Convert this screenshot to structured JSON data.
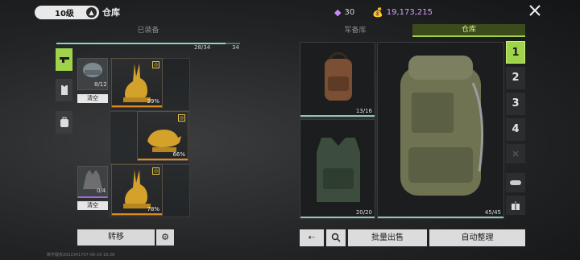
{
  "header": {
    "level_label": "10级",
    "title": "仓库",
    "gems": "30",
    "coins": "19,173,215"
  },
  "left_panel": {
    "section_title": "已装备",
    "capacity_main": "28/34",
    "capacity_side": "34",
    "slot1_count": "8/12",
    "slot2_count": "0/4",
    "clear_label": "清空",
    "items": [
      {
        "percent": "29%"
      },
      {
        "percent": "66%"
      },
      {
        "percent": "78%"
      }
    ],
    "move_label": "转移",
    "version": "数字版权2022341707-06-19-16:28"
  },
  "right_panel": {
    "tab_armory": "军备库",
    "tab_warehouse": "仓库",
    "bags": [
      {
        "capacity": "13/16"
      },
      {
        "capacity": "20/20"
      },
      {
        "capacity": "45/45"
      }
    ],
    "number_tabs": [
      "1",
      "2",
      "3",
      "4"
    ],
    "batch_sell_label": "批量出售",
    "auto_sort_label": "自动整理"
  },
  "colors": {
    "accent": "#9fd34a",
    "gold_bar": "#e08a1c",
    "gem": "#c58cff"
  }
}
